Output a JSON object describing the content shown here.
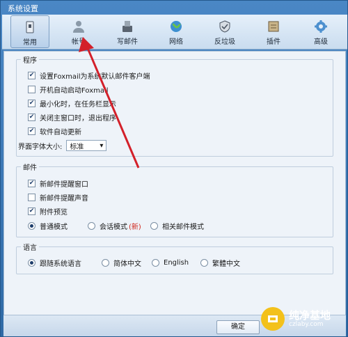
{
  "window": {
    "title": "系统设置"
  },
  "toolbar": [
    {
      "label": "常用",
      "icon": "general-icon",
      "active": true
    },
    {
      "label": "帐号",
      "icon": "account-icon",
      "active": false
    },
    {
      "label": "写邮件",
      "icon": "compose-icon",
      "active": false
    },
    {
      "label": "网络",
      "icon": "network-icon",
      "active": false
    },
    {
      "label": "反垃圾",
      "icon": "antispam-icon",
      "active": false
    },
    {
      "label": "插件",
      "icon": "plugin-icon",
      "active": false
    },
    {
      "label": "高级",
      "icon": "advanced-icon",
      "active": false
    }
  ],
  "program": {
    "title": "程序",
    "options": [
      {
        "label": "设置Foxmail为系统默认邮件客户端",
        "checked": true
      },
      {
        "label": "开机自动启动Foxmail",
        "checked": false
      },
      {
        "label": "最小化时，在任务栏显示",
        "checked": true
      },
      {
        "label": "关闭主窗口时，退出程序",
        "checked": true
      },
      {
        "label": "软件自动更新",
        "checked": true
      }
    ],
    "font_size_label": "界面字体大小:",
    "font_size_value": "标准"
  },
  "mail": {
    "title": "邮件",
    "options": [
      {
        "label": "新邮件提醒窗口",
        "checked": true
      },
      {
        "label": "新邮件提醒声音",
        "checked": false
      },
      {
        "label": "附件预览",
        "checked": true
      }
    ],
    "mode": {
      "normal": "普通模式",
      "conversation": "会话模式",
      "conversation_badge": "(新)",
      "related": "相关邮件模式",
      "selected": "normal"
    }
  },
  "language": {
    "title": "语言",
    "options": [
      "跟随系统语言",
      "简体中文",
      "English",
      "繁體中文"
    ],
    "selected": 0
  },
  "footer": {
    "ok_label": "确定"
  },
  "watermark": {
    "text": "纯净基地",
    "sub": "czlaby.com"
  },
  "colors": {
    "accent": "#2f6aa6",
    "arrow": "#d3202a",
    "badge": "#d0271d"
  }
}
